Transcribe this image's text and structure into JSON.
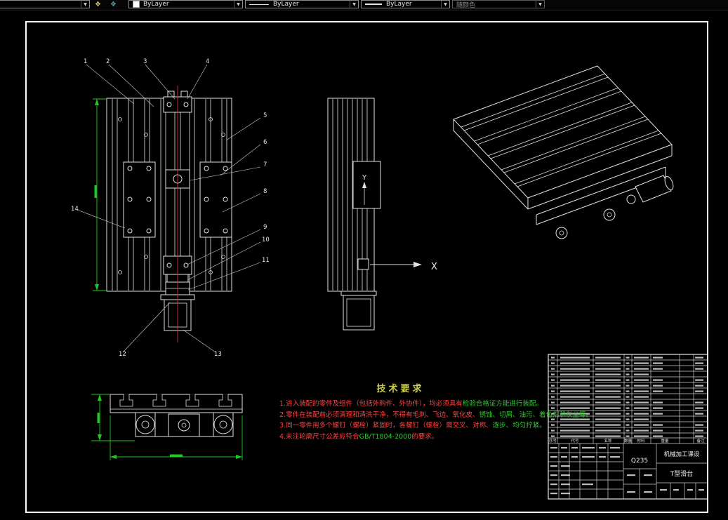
{
  "toolbar": {
    "color_combo": {
      "value": "ByLayer"
    },
    "linetype_combo": {
      "value": "ByLayer"
    },
    "lineweight_combo": {
      "value": "ByLayer"
    },
    "plotstyle_combo": {
      "value": "随颜色"
    }
  },
  "drawing": {
    "axis_labels": {
      "x": "X",
      "y": "Y"
    },
    "callouts": [
      "1",
      "2",
      "3",
      "4",
      "5",
      "6",
      "7",
      "8",
      "9",
      "10",
      "11",
      "12",
      "13",
      "14"
    ]
  },
  "tech_requirements": {
    "title": "技术要求",
    "notes": [
      {
        "segments": [
          {
            "text": "1.进入装配的零件及组件（包括外购件、外协件），均必须具有",
            "color": "#ff4242"
          },
          {
            "text": "检验合格证方能进行装配。",
            "color": "#2ecc2e"
          }
        ]
      },
      {
        "segments": [
          {
            "text": "2.零件在装配前必须清理和清洗干净，不得有毛刺、飞边、氧化皮、",
            "color": "#ff4242"
          },
          {
            "text": "锈蚀、切屑、油污、着色剂和灰尘等。",
            "color": "#2ecc2e"
          }
        ]
      },
      {
        "segments": [
          {
            "text": "3.同一零件用多个螺钉（螺栓）紧固时，各螺钉（螺栓）需交叉、对称、",
            "color": "#ff4242"
          },
          {
            "text": "逐步、均匀拧紧。",
            "color": "#2ecc2e"
          }
        ]
      },
      {
        "segments": [
          {
            "text": "4.未注轮廓尺寸公差应符合",
            "color": "#ff4242"
          },
          {
            "text": "GB/T1804-2000",
            "color": "#2ecc2e"
          },
          {
            "text": "的要求。",
            "color": "#ff4242"
          }
        ]
      }
    ]
  },
  "title_block": {
    "material": "Q235",
    "unit_name": "机械加工课设",
    "drawing_name": "T型滑台",
    "bom_headers": [
      "序号",
      "代号",
      "名称",
      "数量",
      "材料",
      "重量",
      "备注"
    ]
  }
}
